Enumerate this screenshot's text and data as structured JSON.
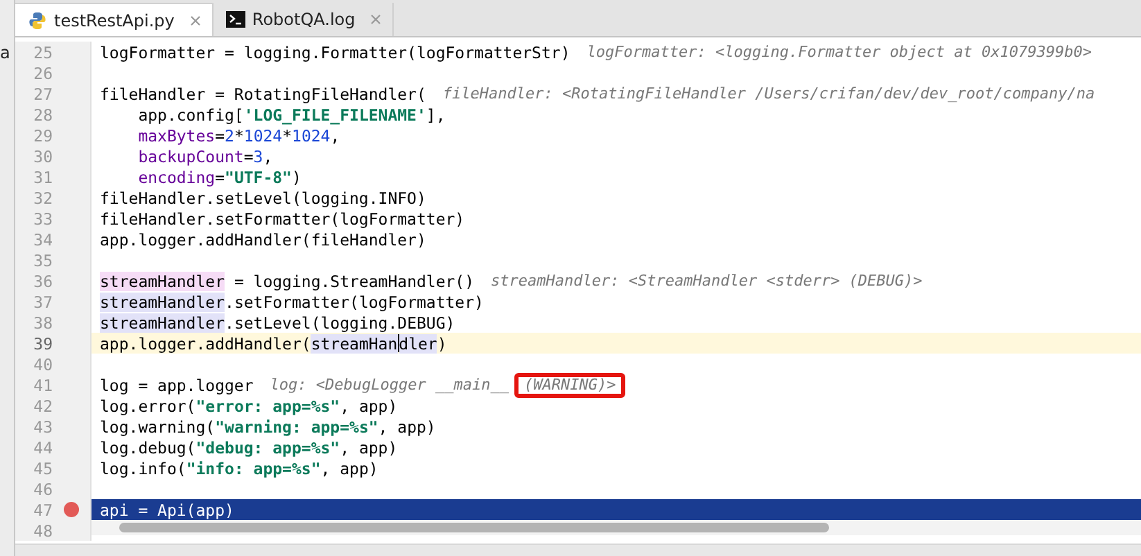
{
  "tabs": [
    {
      "label": "testRestApi.py",
      "selected": true
    },
    {
      "label": "RobotQA.log",
      "selected": false
    }
  ],
  "side_panel": {
    "text": "a"
  },
  "lines": [
    {
      "number": "25",
      "current": false,
      "selected": false,
      "breakpoint": false,
      "code": [
        {
          "kind": "plain",
          "text": "logFormatter = logging.Formatter(logFormatterStr)"
        }
      ],
      "hints": [
        {
          "text": "logFormatter: <logging.Formatter object at 0x1079399b0>",
          "boxed": false
        }
      ]
    },
    {
      "number": "26",
      "current": false,
      "selected": false,
      "breakpoint": false
    },
    {
      "number": "27",
      "current": false,
      "selected": false,
      "breakpoint": false,
      "code": [
        {
          "kind": "plain",
          "text": "fileHandler = RotatingFileHandler("
        }
      ],
      "hints": [
        {
          "text": "fileHandler: <RotatingFileHandler /Users/crifan/dev/dev_root/company/na",
          "boxed": false
        }
      ]
    },
    {
      "number": "28",
      "current": false,
      "selected": false,
      "breakpoint": false,
      "indented": true,
      "code": [
        {
          "kind": "plain",
          "text": "app.config["
        },
        {
          "kind": "string",
          "text": "'LOG_FILE_FILENAME'"
        },
        {
          "kind": "plain",
          "text": "],"
        }
      ]
    },
    {
      "number": "29",
      "current": false,
      "selected": false,
      "breakpoint": false,
      "indented": true,
      "code": [
        {
          "kind": "kwarg",
          "text": "maxBytes"
        },
        {
          "kind": "plain",
          "text": "="
        },
        {
          "kind": "number",
          "text": "2"
        },
        {
          "kind": "plain",
          "text": "*"
        },
        {
          "kind": "number",
          "text": "1024"
        },
        {
          "kind": "plain",
          "text": "*"
        },
        {
          "kind": "number",
          "text": "1024"
        },
        {
          "kind": "plain",
          "text": ","
        }
      ]
    },
    {
      "number": "30",
      "current": false,
      "selected": false,
      "breakpoint": false,
      "indented": true,
      "code": [
        {
          "kind": "kwarg",
          "text": "backupCount"
        },
        {
          "kind": "plain",
          "text": "="
        },
        {
          "kind": "number",
          "text": "3"
        },
        {
          "kind": "plain",
          "text": ","
        }
      ]
    },
    {
      "number": "31",
      "current": false,
      "selected": false,
      "breakpoint": false,
      "indented": true,
      "code": [
        {
          "kind": "kwarg",
          "text": "encoding"
        },
        {
          "kind": "plain",
          "text": "="
        },
        {
          "kind": "string",
          "text": "\"UTF-8\""
        },
        {
          "kind": "plain",
          "text": ")"
        }
      ]
    },
    {
      "number": "32",
      "current": false,
      "selected": false,
      "breakpoint": false,
      "code": [
        {
          "kind": "plain",
          "text": "fileHandler.setLevel(logging.INFO)"
        }
      ]
    },
    {
      "number": "33",
      "current": false,
      "selected": false,
      "breakpoint": false,
      "code": [
        {
          "kind": "plain",
          "text": "fileHandler.setFormatter(logFormatter)"
        }
      ]
    },
    {
      "number": "34",
      "current": false,
      "selected": false,
      "breakpoint": false,
      "code": [
        {
          "kind": "plain",
          "text": "app.logger.addHandler(fileHandler)"
        }
      ]
    },
    {
      "number": "35",
      "current": false,
      "selected": false,
      "breakpoint": false
    },
    {
      "number": "36",
      "current": false,
      "selected": false,
      "breakpoint": false,
      "code": [
        {
          "kind": "write",
          "text": "streamHandler"
        },
        {
          "kind": "plain",
          "text": " = logging.StreamHandler()"
        }
      ],
      "hints": [
        {
          "text": "streamHandler: <StreamHandler <stderr> (DEBUG)>",
          "boxed": false
        }
      ]
    },
    {
      "number": "37",
      "current": false,
      "selected": false,
      "breakpoint": false,
      "code": [
        {
          "kind": "read",
          "text": "streamHandler"
        },
        {
          "kind": "plain",
          "text": ".setFormatter(logFormatter)"
        }
      ]
    },
    {
      "number": "38",
      "current": false,
      "selected": false,
      "breakpoint": false,
      "code": [
        {
          "kind": "read",
          "text": "streamHandler"
        },
        {
          "kind": "plain",
          "text": ".setLevel(logging.DEBUG)"
        }
      ]
    },
    {
      "number": "39",
      "current": true,
      "selected": false,
      "breakpoint": false,
      "code": [
        {
          "kind": "plain",
          "text": "app.logger.addHandler("
        },
        {
          "kind": "read",
          "text": "streamHan"
        },
        {
          "kind": "caret"
        },
        {
          "kind": "read",
          "text": "dler"
        },
        {
          "kind": "plain",
          "text": ")"
        }
      ]
    },
    {
      "number": "40",
      "current": false,
      "selected": false,
      "breakpoint": false
    },
    {
      "number": "41",
      "current": false,
      "selected": false,
      "breakpoint": false,
      "code": [
        {
          "kind": "plain",
          "text": "log = app.logger"
        }
      ],
      "hints": [
        {
          "text": "log: <DebugLogger __main__",
          "boxed": false
        },
        {
          "text": "(WARNING)>",
          "boxed": true
        }
      ]
    },
    {
      "number": "42",
      "current": false,
      "selected": false,
      "breakpoint": false,
      "code": [
        {
          "kind": "plain",
          "text": "log.error("
        },
        {
          "kind": "string",
          "text": "\"error: app=%s\""
        },
        {
          "kind": "plain",
          "text": ", app)"
        }
      ]
    },
    {
      "number": "43",
      "current": false,
      "selected": false,
      "breakpoint": false,
      "code": [
        {
          "kind": "plain",
          "text": "log.warning("
        },
        {
          "kind": "string",
          "text": "\"warning: app=%s\""
        },
        {
          "kind": "plain",
          "text": ", app)"
        }
      ]
    },
    {
      "number": "44",
      "current": false,
      "selected": false,
      "breakpoint": false,
      "code": [
        {
          "kind": "plain",
          "text": "log.debug("
        },
        {
          "kind": "string",
          "text": "\"debug: app=%s\""
        },
        {
          "kind": "plain",
          "text": ", app)"
        }
      ]
    },
    {
      "number": "45",
      "current": false,
      "selected": false,
      "breakpoint": false,
      "code": [
        {
          "kind": "plain",
          "text": "log.info("
        },
        {
          "kind": "string",
          "text": "\"info: app=%s\""
        },
        {
          "kind": "plain",
          "text": ", app)"
        }
      ]
    },
    {
      "number": "46",
      "current": false,
      "selected": false,
      "breakpoint": false
    },
    {
      "number": "47",
      "current": false,
      "selected": true,
      "breakpoint": true,
      "code": [
        {
          "kind": "plain",
          "text": "api = Api(app)"
        }
      ]
    },
    {
      "number": "48",
      "current": false,
      "selected": false,
      "breakpoint": false
    }
  ]
}
